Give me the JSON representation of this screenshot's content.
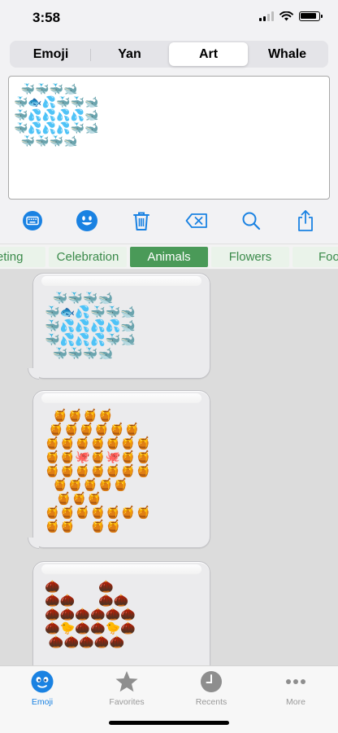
{
  "status_bar": {
    "time": "3:58"
  },
  "segments": [
    {
      "label": "Emoji"
    },
    {
      "label": "Yan"
    },
    {
      "label": "Art",
      "active": true
    },
    {
      "label": "Whale"
    }
  ],
  "editor": {
    "art": "  🐳🐳🐳🐋\n🐳🐟💦🐳🐳🐋\n🐳💦💦💦💦🐋\n🐳💦💦💦🐳🐋\n  🐳🐳🐳🐋"
  },
  "toolbar": {
    "icons": [
      "keyboard-icon",
      "emoji-face-icon",
      "trash-icon",
      "backspace-icon",
      "search-icon",
      "share-icon"
    ],
    "accent": "#1a82e2"
  },
  "categories": [
    {
      "label": "eeting"
    },
    {
      "label": "Celebration"
    },
    {
      "label": "Animals",
      "active": true
    },
    {
      "label": "Flowers"
    },
    {
      "label": "Foo"
    }
  ],
  "category_colors": {
    "active_bg": "#4a9a58",
    "text": "#3a8a4a"
  },
  "messages": [
    {
      "art": "  🐳🐳🐳🐋\n🐳🐟💦🐳🐳🐋\n🐳💦💦💦💦🐋\n🐳💦💦💦🐳🐋\n  🐳🐳🐳🐋"
    },
    {
      "art": "  🍯🍯🍯🍯\n 🍯🍯🍯🍯🍯🍯\n🍯🍯🍯🍯🍯🍯🍯\n🍯🍯🐙🍯🐙🍯🍯\n🍯🍯🍯🍯🍯🍯🍯\n  🍯🍯🍯🍯🍯\n   🍯🍯🍯\n🍯🍯🍯🍯🍯🍯🍯\n🍯🍯    🍯🍯"
    },
    {
      "art": "🌰          🌰\n🌰🌰      🌰🌰\n🌰🌰🌰🌰🌰🌰\n🌰🐤🌰🌰🐤🌰\n 🌰🌰🌰🌰🌰"
    }
  ],
  "tabs": [
    {
      "label": "Emoji",
      "icon": "smiley-face-icon",
      "active": true
    },
    {
      "label": "Favorites",
      "icon": "star-icon"
    },
    {
      "label": "Recents",
      "icon": "clock-icon"
    },
    {
      "label": "More",
      "icon": "more-dots-icon"
    }
  ]
}
